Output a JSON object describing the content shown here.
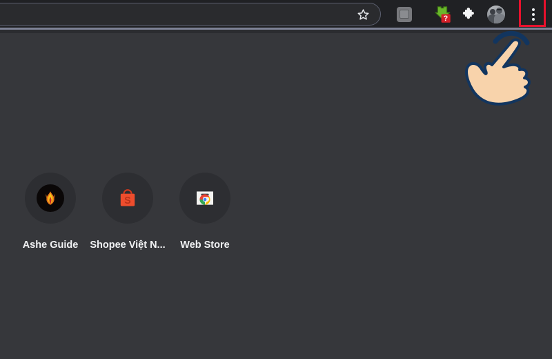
{
  "browser": {
    "theme": "dark",
    "colors": {
      "toolbar_bg": "#202124",
      "page_bg": "#36373b",
      "separator": "#7e8397",
      "highlight_red": "#e8112d",
      "tile_bg": "#2d2e32",
      "label_text": "#f1f2f4",
      "download_green": "#6ab72b",
      "badge_red": "#d32029",
      "shopee_orange": "#ee4d2d",
      "hand_skin": "#f8d3ab",
      "hand_outline": "#1b3a66"
    },
    "omnibox": {
      "value": "",
      "placeholder": "",
      "bookmark_icon": "star-icon"
    },
    "toolbar_icons": [
      {
        "name": "disabled-extension-icon",
        "label": "",
        "state": "disabled"
      },
      {
        "name": "download-icon",
        "label": "",
        "badge": "?"
      },
      {
        "name": "extensions-puzzle-icon",
        "label": ""
      },
      {
        "name": "profile-avatar",
        "label": ""
      },
      {
        "name": "chrome-menu-icon",
        "label": "",
        "highlighted": true
      }
    ],
    "menu_highlight": {
      "visible": true,
      "color": "#e8112d"
    },
    "cursor": {
      "type": "pointing-hand",
      "gesture": "tap-arc",
      "target": "chrome-menu-icon"
    }
  },
  "newtab": {
    "shortcuts": [
      {
        "label": "Ashe Guide",
        "icon": "ashe-guide-favicon"
      },
      {
        "label": "Shopee Việt N...",
        "icon": "shopee-favicon"
      },
      {
        "label": "Web Store",
        "icon": "chrome-web-store-favicon"
      }
    ]
  }
}
